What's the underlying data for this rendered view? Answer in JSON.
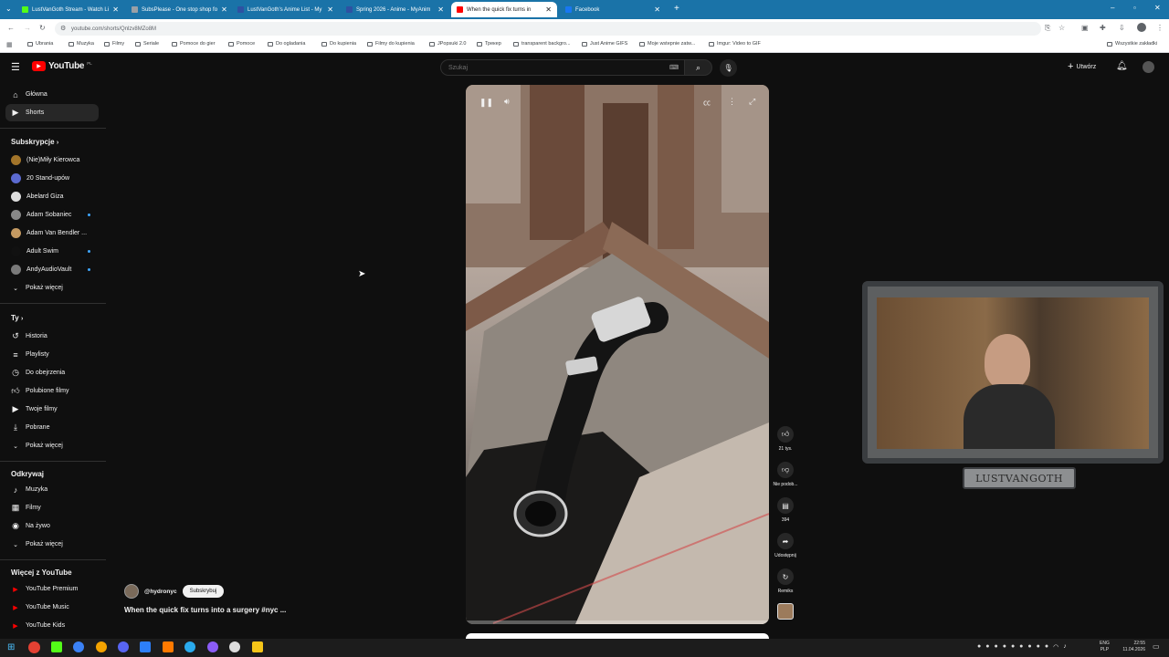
{
  "browser": {
    "tabs": [
      {
        "title": "LustVanGoth Stream - Watch Li",
        "color": "#53fc18"
      },
      {
        "title": "SubsPlease - One stop shop fo",
        "color": "#9aa0a6"
      },
      {
        "title": "LustVanGoth's Anime List - My",
        "color": "#2e51a2"
      },
      {
        "title": "Spring 2026 - Anime - MyAnim",
        "color": "#2e51a2"
      },
      {
        "title": "When the quick fix turns in",
        "color": "#ff0000"
      },
      {
        "title": "Facebook",
        "color": "#1877f2"
      }
    ],
    "new_tab": "+",
    "url": "youtube.com/shorts/Qnlzv8MZo8M",
    "bookmarks": [
      "Ubrania",
      "Muzyka",
      "Filmy",
      "Seriale",
      "Pomoce do gier",
      "Pomoce",
      "Do ogladania",
      "Do kupienia",
      "Filmy do kupienia",
      "JPopsuki 2.0",
      "Трекер",
      "transparent backgro...",
      "Just Anime GIFS",
      "Moje wstepnie zatw...",
      "Imgur: Video to GIF"
    ],
    "all_bookmarks": "Wszystkie zakładki"
  },
  "youtube": {
    "logo": "YouTube",
    "logo_region": "PL",
    "search_placeholder": "Szukaj",
    "create_label": "Utwórz",
    "sidebar": {
      "main": [
        {
          "label": "Główna",
          "icon": "home-icon"
        },
        {
          "label": "Shorts",
          "icon": "shorts-icon"
        }
      ],
      "subs_header": "Subskrypcje",
      "subs": [
        {
          "label": "(Nie)Miły Kierowca",
          "color": "#a3752a",
          "dot": false
        },
        {
          "label": "20 Stand-upów",
          "color": "#5b6ad0",
          "dot": false
        },
        {
          "label": "Abelard Giza",
          "color": "#dddddd",
          "dot": false
        },
        {
          "label": "Adam Sobaniec",
          "color": "#888888",
          "dot": true
        },
        {
          "label": "Adam Van Bendler ...",
          "color": "#c49a62",
          "dot": false
        },
        {
          "label": "Adult Swim",
          "color": "#111111",
          "dot": true
        },
        {
          "label": "AndyAudioVault",
          "color": "#7a7a7a",
          "dot": true
        }
      ],
      "subs_more": "Pokaż więcej",
      "you_header": "Ty",
      "you": [
        {
          "label": "Historia",
          "icon": "history-icon"
        },
        {
          "label": "Playlisty",
          "icon": "playlist-icon"
        },
        {
          "label": "Do obejrzenia",
          "icon": "watch-later-icon"
        },
        {
          "label": "Polubione filmy",
          "icon": "like-icon"
        },
        {
          "label": "Twoje filmy",
          "icon": "your-videos-icon"
        },
        {
          "label": "Pobrane",
          "icon": "download-icon"
        }
      ],
      "you_more": "Pokaż więcej",
      "explore_header": "Odkrywaj",
      "explore": [
        {
          "label": "Muzyka",
          "icon": "music-icon"
        },
        {
          "label": "Filmy",
          "icon": "film-icon"
        },
        {
          "label": "Na żywo",
          "icon": "live-icon"
        }
      ],
      "explore_more": "Pokaż więcej",
      "more_header": "Więcej z YouTube",
      "more": [
        {
          "label": "YouTube Premium"
        },
        {
          "label": "YouTube Music"
        },
        {
          "label": "YouTube Kids"
        }
      ]
    },
    "short": {
      "channel": "@hydronyc",
      "subscribe": "Subskrybuj",
      "title": "When the quick fix turns into a surgery #nyc ...",
      "likes": "21 tys.",
      "dislike_label": "Nie podob...",
      "comments": "394",
      "share_label": "Udostępnij",
      "remix_label": "Remiks",
      "progress": 0.0
    },
    "overlay": {
      "streamer_name": "LUSTVANGOTH"
    }
  },
  "taskbar": {
    "lang1": "ENG",
    "lang2": "PLP",
    "time": "22:55",
    "date": "11.04.2026"
  }
}
